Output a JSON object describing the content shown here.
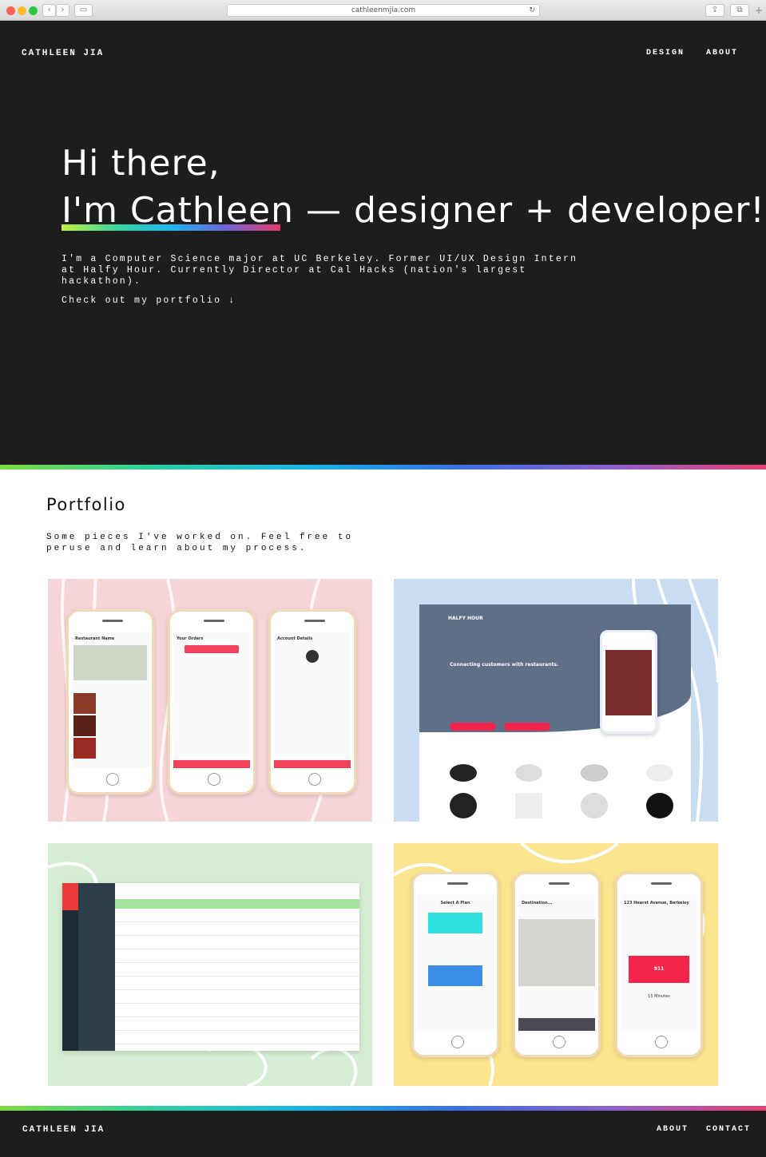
{
  "browser": {
    "url": "cathleenmjia.com"
  },
  "header": {
    "brand": "CATHLEEN JIA",
    "nav": [
      "DESIGN",
      "ABOUT"
    ]
  },
  "hero": {
    "line1": "Hi there,",
    "name": "I'm Cathleen",
    "rest": " — designer + developer!",
    "intro": "I'm a Computer Science major at UC Berkeley. Former UI/UX Design Intern at Halfy Hour. Currently Director at Cal Hacks (nation's largest hackathon).",
    "cta": "Check out my portfolio ↓"
  },
  "portfolio": {
    "title": "Portfolio",
    "description": "Some pieces I've worked on. Feel free to peruse and learn about my process.",
    "tiles": [
      {
        "bg": "#f6d5d8",
        "screens": [
          "Restaurant Name",
          "Your Orders",
          "Account Details"
        ]
      },
      {
        "bg": "#c9ddf2",
        "brand": "HALFY HOUR",
        "headline": "Connecting customers with restaurants."
      },
      {
        "bg": "#d5edd2"
      },
      {
        "bg": "#fbe58f",
        "screens": [
          "Select A Plan",
          "Destination...",
          "123 Hearst Avenue, Berkeley"
        ],
        "button": "911",
        "eta": "15 Minutes"
      }
    ]
  },
  "footer": {
    "brand": "CATHLEEN JIA",
    "nav": [
      "ABOUT",
      "CONTACT"
    ]
  }
}
